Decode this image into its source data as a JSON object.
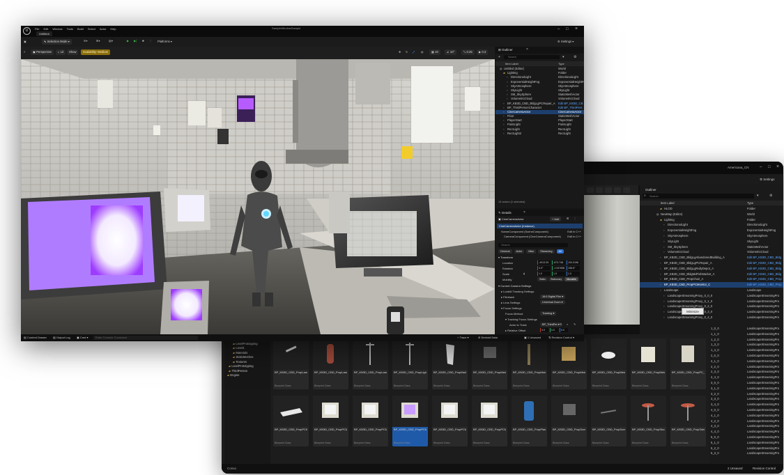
{
  "front": {
    "project": "SampleWindowSample",
    "tab": "Untitled",
    "menu": [
      "File",
      "Edit",
      "Window",
      "Tools",
      "Build",
      "Select",
      "Actor",
      "Help"
    ],
    "toolbar": {
      "mode": "Selection Mode",
      "platforms": "Platforms",
      "settings": "Settings"
    },
    "viewport": {
      "perspective": "Perspective",
      "lit": "Lit",
      "show": "Show",
      "scalability": "Scalability: Medium",
      "snap1": "10",
      "snap2": "10°",
      "snap3": "0.25",
      "snap4": "4",
      "grid": "0.3"
    },
    "outliner": {
      "title": "Outliner",
      "search": "Search",
      "col_label": "Item Label",
      "col_type": "Type",
      "rows": [
        {
          "label": "Untitled (Editor)",
          "type": "World",
          "indent": 0
        },
        {
          "label": "Lighting",
          "type": "Folder",
          "indent": 1
        },
        {
          "label": "DirectionalLight",
          "type": "DirectionalLight",
          "indent": 2
        },
        {
          "label": "ExponentialHeightFog",
          "type": "ExponentialHeightFog",
          "indent": 2
        },
        {
          "label": "SkyAtmosphere",
          "type": "SkyAtmosphere",
          "indent": 2
        },
        {
          "label": "SkyLight",
          "type": "SkyLight",
          "indent": 2
        },
        {
          "label": "SM_SkySphere",
          "type": "StaticMeshActor",
          "indent": 2
        },
        {
          "label": "VolumetricCloud",
          "type": "VolumetricCloud",
          "indent": 2
        },
        {
          "label": "BP_KB3D_CBD_BldgLgPCRepair_A",
          "type": "Edit BP_KB3D_CB",
          "indent": 1,
          "link": true
        },
        {
          "label": "BP_ThirdPersonCharacter",
          "type": "Edit BP_ThirdPers",
          "indent": 1,
          "link": true
        },
        {
          "label": "CineCameraActor",
          "type": "CineCameraActor",
          "indent": 1,
          "selected": true
        },
        {
          "label": "Floor",
          "type": "StaticMeshActor",
          "indent": 1
        },
        {
          "label": "PlayerStart",
          "type": "PlayerStart",
          "indent": 1
        },
        {
          "label": "PointLight",
          "type": "PointLight",
          "indent": 1
        },
        {
          "label": "RectLight",
          "type": "RectLight",
          "indent": 1
        },
        {
          "label": "RectLight2",
          "type": "RectLight",
          "indent": 1
        }
      ],
      "status": "14 actors (1 selected)"
    },
    "details": {
      "title": "Details",
      "actor": "CineCameraActor",
      "add": "+ Add",
      "instance": "CineCameraActor (Instance)",
      "comp1": "SceneComponent (SceneComponent)",
      "comp1_edit": "Edit in C++",
      "comp2": "CameraComponent (CineCameraComponent)",
      "comp2_edit": "Edit in C++",
      "search": "Search",
      "tabs": [
        "General",
        "Actor",
        "Misc",
        "Streaming",
        "All"
      ],
      "transform": "Transform",
      "location": "Location",
      "loc": [
        "-4913.09",
        "-873.748",
        "100.0156"
      ],
      "rotation": "Rotation",
      "rot": [
        "0.0°",
        "-1.947656",
        "198.6°"
      ],
      "scale": "Scale",
      "scl": [
        "1.0",
        "1.0",
        "1.0"
      ],
      "mobility": "Mobility",
      "mob": [
        "Static",
        "Stationary",
        "Movable"
      ],
      "section2": "Current Camera Settings",
      "lookat": "LookAt Tracking Settings",
      "filmback": "Filmback",
      "filmback_val": "16:9 Digital Film",
      "lens": "Lens Settings",
      "lens_val": "Universal Zoom",
      "focus": "Focus Settings",
      "focus_method": "Focus Method",
      "focus_method_val": "Tracking",
      "tracking": "Tracking Focus Settings",
      "actor_track": "Actor to Track",
      "actor_track_val": "BP_ThirdPer",
      "rel_offset": "Relative Offset",
      "rel_vals": [
        "0.0",
        "0.0",
        "0.0"
      ],
      "debug_focus": "Draw Debug Focus",
      "debug_plane": "Draw Debug Focus Pl"
    },
    "bottom": {
      "content": "Content Drawer",
      "output": "Output Log",
      "cmd": "Cmd",
      "console": "Enter Console Command",
      "trace": "Trace",
      "derived": "Derived Data",
      "unsaved": "1 Unsaved",
      "revision": "Revision Control"
    }
  },
  "back": {
    "project": "Americana_CN",
    "settings": "Settings",
    "outliner": {
      "title": "Outliner",
      "search": "Search",
      "col_label": "Item Label",
      "col_type": "Type",
      "rows": [
        {
          "label": "HLOD",
          "type": "Folder",
          "indent": 1
        },
        {
          "label": "NewMap (Editor)",
          "type": "World",
          "indent": 0
        },
        {
          "label": "Lighting",
          "type": "Folder",
          "indent": 1
        },
        {
          "label": "DirectionalLight",
          "type": "DirectionalLight",
          "indent": 2
        },
        {
          "label": "ExponentialHeightFog",
          "type": "ExponentialHeightFog",
          "indent": 2
        },
        {
          "label": "SkyAtmosphere",
          "type": "SkyAtmosphere",
          "indent": 2
        },
        {
          "label": "SkyLight",
          "type": "SkyLight",
          "indent": 2
        },
        {
          "label": "SM_SkySphere",
          "type": "StaticMeshActor",
          "indent": 2
        },
        {
          "label": "VolumetricCloud",
          "type": "VolumetricCloud",
          "indent": 2
        },
        {
          "label": "BP_KB3D_CBD_BldgLgAbandonedBuilding_A",
          "type": "Edit BP_KB3D_CBD_Bldg",
          "indent": 1,
          "link": true
        },
        {
          "label": "BP_KB3D_CBD_BldgLgPCRepair_A",
          "type": "Edit BP_KB3D_CBD_Bldg",
          "indent": 1,
          "link": true
        },
        {
          "label": "BP_KB3D_CBD_BldgLgRallyDepot_A",
          "type": "Edit BP_KB3D_CBD_Bldg",
          "indent": 1,
          "link": true
        },
        {
          "label": "BP_KB3D_CBD_BldgMdFishMarket_A",
          "type": "Edit BP_KB3D_CBD_Bldg",
          "indent": 1,
          "link": true
        },
        {
          "label": "BP_KB3D_CBD_PropChair_A",
          "type": "Edit BP_KB3D_CBD_Prop",
          "indent": 1,
          "link": true
        },
        {
          "label": "BP_KB3D_CBD_PropPCMonitor_C",
          "type": "Edit BP_KB3D_CBD_Prop",
          "indent": 1,
          "link": true,
          "selected": true
        },
        {
          "label": "Landscape",
          "type": "Landscape",
          "indent": 1
        },
        {
          "label": "LandscapeStreamingProxy_0_0_0",
          "type": "LandscapeStreamingPro",
          "indent": 2
        },
        {
          "label": "LandscapeStreamingProxy_0_1_0",
          "type": "LandscapeStreamingPro",
          "indent": 2
        },
        {
          "label": "LandscapeStreamingProxy_0_2_0",
          "type": "LandscapeStreamingPro",
          "indent": 2
        },
        {
          "label": "LandscapeStreamingProxy_0_3_0",
          "type": "LandscapeStreamingPro",
          "indent": 2
        },
        {
          "label": "LandscapeStreamingProxy_0_4_0",
          "type": "LandscapeStreamingPro",
          "indent": 2
        }
      ],
      "tooltip": "Minimize",
      "proxy_suffixes": [
        "1_0_0",
        "1_1_0",
        "1_2_0",
        "1_3_0",
        "1_4_0",
        "2_0_0",
        "2_1_0",
        "2_2_0",
        "2_3_0",
        "2_4_0",
        "3_0_0",
        "3_1_0",
        "3_2_0",
        "3_3_0",
        "3_4_0",
        "4_0_0",
        "4_1_0",
        "4_2_0",
        "4_3_0",
        "4_4_0",
        "5_0_0",
        "5_1_0",
        "5_2_0",
        "5_3_0"
      ]
    },
    "content_tree": [
      "Landscape",
      "LevelPrototyping",
      "Levels",
      "Materials",
      "StaticMeshes",
      "Textures",
      "LevelPrototyping",
      "ThirdPerson",
      "Engine"
    ],
    "assets_row1": [
      {
        "name": "BP_KB3D_CBD_PropLamp_C",
        "type": "Blueprint Class"
      },
      {
        "name": "BP_KB3D_CBD_PropLamp_D",
        "type": "Blueprint Class"
      },
      {
        "name": "BP_KB3D_CBD_PropLamp_E",
        "type": "Blueprint Class"
      },
      {
        "name": "BP_KB3D_CBD_PropLightPole_C",
        "type": "Blueprint Class"
      },
      {
        "name": "BP_KB3D_CBD_PropMailbox_A",
        "type": "Blueprint Class"
      },
      {
        "name": "BP_KB3D_CBD_PropMetalScreen_A",
        "type": "Blueprint Class"
      },
      {
        "name": "BP_KB3D_CBD_PropMetalSign_A",
        "type": "Blueprint Class"
      },
      {
        "name": "BP_KB3D_CBD_PropMetalBarricade_A",
        "type": "Blueprint Class"
      },
      {
        "name": "BP_KB3D_CBD_PropMetalSign_D",
        "type": "Blueprint Class"
      },
      {
        "name": "BP_KB3D_CBD_PropMetalSign_E",
        "type": "Blueprint Class"
      },
      {
        "name": "BP_KB3D_CBD_PropPC_A",
        "type": "Blueprint Class"
      }
    ],
    "assets_row2": [
      {
        "name": "BP_KB3D_CBD_PropPCKeyboard_A",
        "type": "Blueprint Class"
      },
      {
        "name": "BP_KB3D_CBD_PropPCMonitor_A",
        "type": "Blueprint Class"
      },
      {
        "name": "BP_KB3D_CBD_PropPCMonitor_B",
        "type": "Blueprint Class"
      },
      {
        "name": "BP_KB3D_CBD_PropPCMonitor_C",
        "type": "Blueprint Class",
        "selected": true
      },
      {
        "name": "BP_KB3D_CBD_PropPCMonitor_D",
        "type": "Blueprint Class"
      },
      {
        "name": "BP_KB3D_CBD_PropPCMonitor_E",
        "type": "Blueprint Class"
      },
      {
        "name": "BP_KB3D_CBD_PropPlasticBarrel_A",
        "type": "Blueprint Class"
      },
      {
        "name": "BP_KB3D_CBD_PropScreen_B",
        "type": "Blueprint Class"
      },
      {
        "name": "BP_KB3D_CBD_PropScrewdriver_A",
        "type": "Blueprint Class"
      },
      {
        "name": "BP_KB3D_CBD_PropStool_C",
        "type": "Blueprint Class"
      },
      {
        "name": "BP_KB3D_CBD_PropTable_C",
        "type": "Blueprint Class"
      }
    ],
    "bottom": {
      "console": "Conso",
      "unsaved": "2 Unsaved",
      "revision": "Revision Control"
    }
  }
}
